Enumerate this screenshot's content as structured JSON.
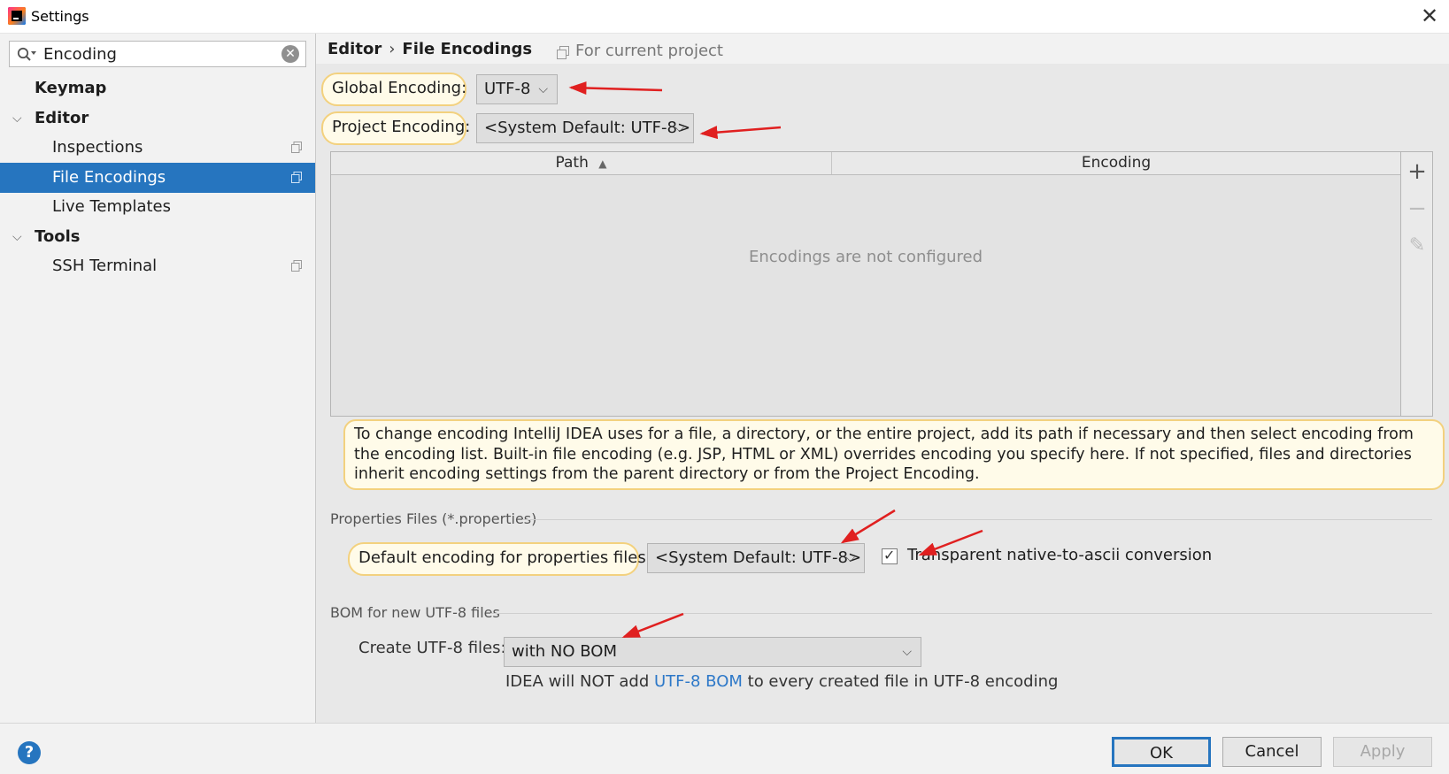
{
  "window": {
    "title": "Settings",
    "close_label": "✕"
  },
  "search": {
    "value": "Encoding",
    "clear_label": "✕"
  },
  "tree": {
    "items": [
      {
        "label": "Keymap"
      },
      {
        "label": "Editor"
      },
      {
        "label": "Inspections"
      },
      {
        "label": "File Encodings"
      },
      {
        "label": "Live Templates"
      },
      {
        "label": "Tools"
      },
      {
        "label": "SSH Terminal"
      }
    ],
    "expand_glyph": "⌵"
  },
  "breadcrumb": {
    "parent": "Editor",
    "separator": "›",
    "current": "File Encodings",
    "scope": "For current project"
  },
  "encodings": {
    "global_label": "Global Encoding:",
    "global_value": "UTF-8",
    "project_label": "Project Encoding:",
    "project_value": "<System Default: UTF-8>",
    "combo_arrow": "⌵"
  },
  "table": {
    "col_path": "Path",
    "sort_glyph": "▲",
    "col_encoding": "Encoding",
    "empty": "Encodings are not configured",
    "add_glyph": "+",
    "remove_glyph": "−",
    "edit_glyph": "✎"
  },
  "hint": "To change encoding IntelliJ IDEA uses for a file, a directory, or the entire project, add its path if necessary and then select encoding from the encoding list. Built-in file encoding (e.g. JSP, HTML or XML) overrides encoding you specify here. If not specified, files and directories inherit encoding settings from the parent directory or from the Project Encoding.",
  "properties": {
    "section": "Properties Files (*.properties)",
    "default_label": "Default encoding for properties files:",
    "default_value": "<System Default: UTF-8>",
    "checkbox_checked": true,
    "check_glyph": "✓",
    "checkbox_label": "Transparent native-to-ascii conversion"
  },
  "bom": {
    "section": "BOM for new UTF-8 files",
    "create_label": "Create UTF-8 files:",
    "create_value": "with NO BOM",
    "info_prefix": "IDEA will NOT add ",
    "info_link": "UTF-8 BOM",
    "info_suffix": " to every created file in UTF-8 encoding"
  },
  "buttons": {
    "help": "?",
    "ok": "OK",
    "cancel": "Cancel",
    "apply": "Apply"
  },
  "colors": {
    "accent": "#2675bf",
    "highlight_border": "#f3d17e",
    "annotation_arrow": "#e02020"
  }
}
